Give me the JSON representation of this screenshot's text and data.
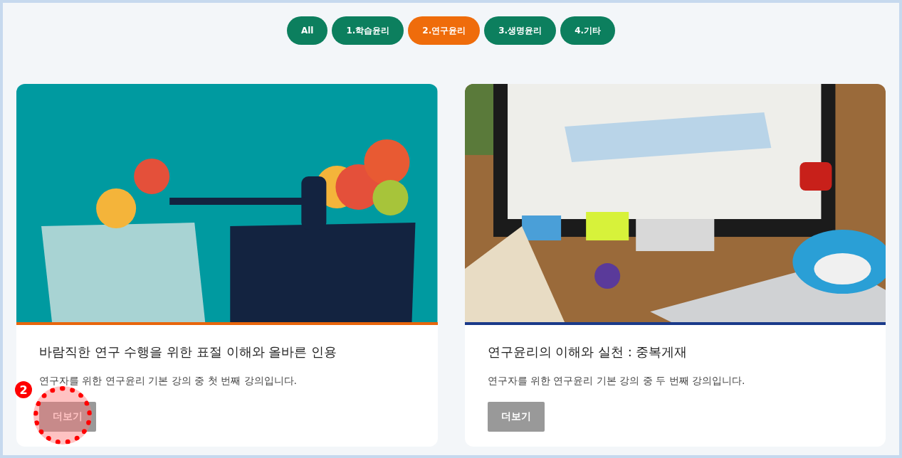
{
  "filters": [
    {
      "label": "All",
      "selected": false
    },
    {
      "label": "1.학습윤리",
      "selected": false
    },
    {
      "label": "2.연구윤리",
      "selected": true
    },
    {
      "label": "3.생명윤리",
      "selected": false
    },
    {
      "label": "4.기타",
      "selected": false
    }
  ],
  "cards": [
    {
      "color": "#e8650c",
      "title": "바람직한 연구 수행을 위한 표절 이해와 올바른 인용",
      "description": "연구자를 위한 연구윤리 기본 강의 중 첫 번째 강의입니다.",
      "button": "더보기",
      "annotation": "2"
    },
    {
      "color": "#1a3a8a",
      "title": "연구윤리의 이해와 실천 : 중복게재",
      "description": "연구자를 위한 연구윤리 기본 강의 중 두 번째 강의입니다.",
      "button": "더보기"
    }
  ]
}
